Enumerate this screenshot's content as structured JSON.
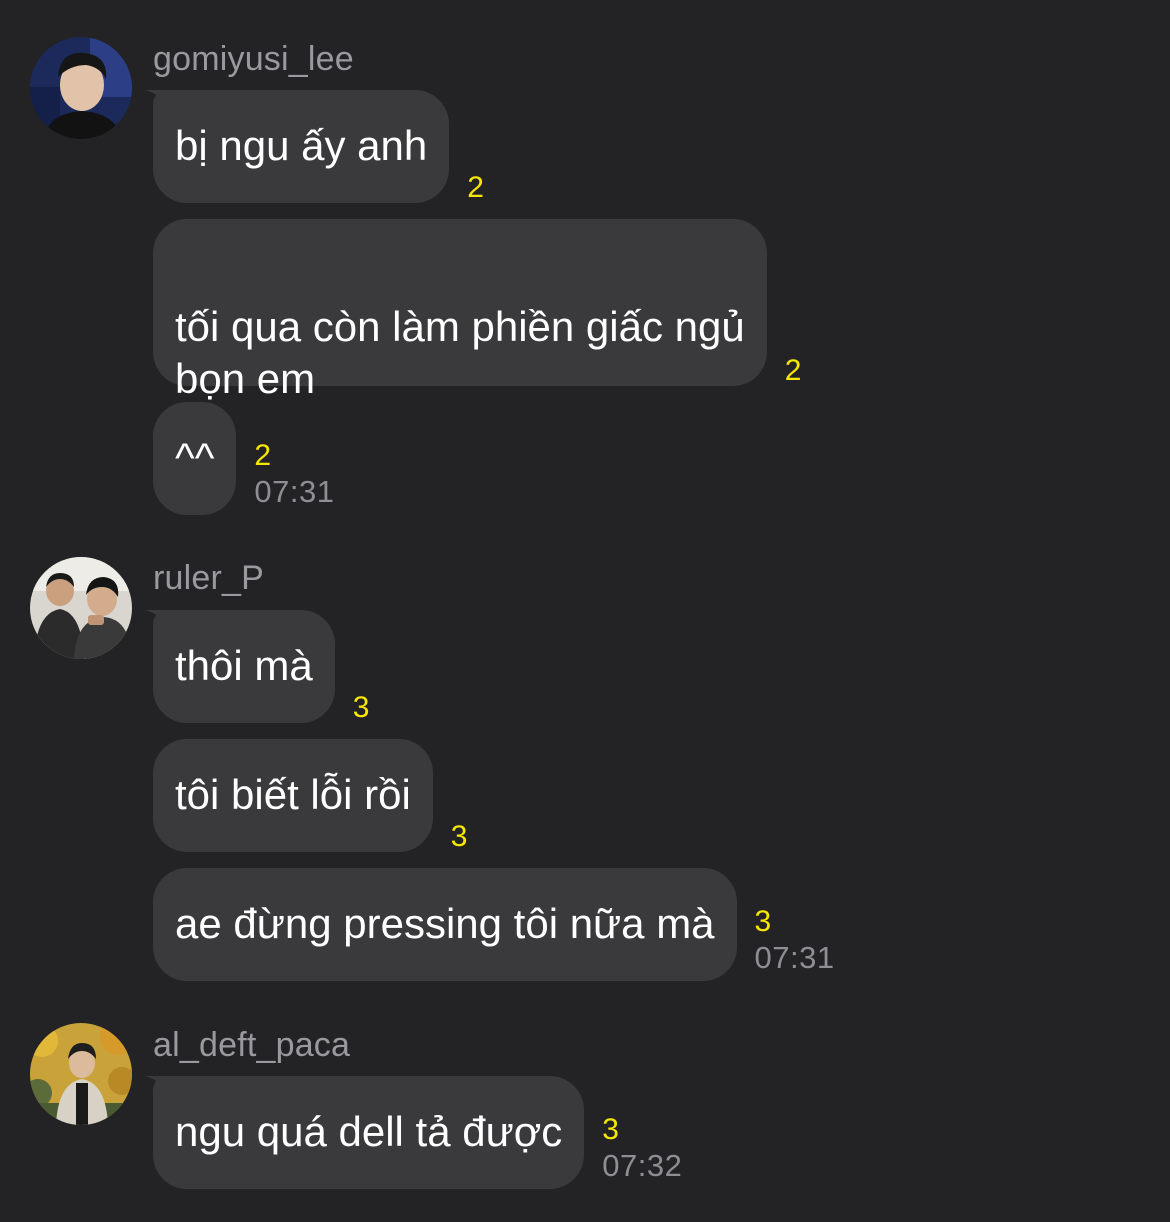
{
  "groups": [
    {
      "username": "gomiyusi_lee",
      "messages": [
        {
          "text": "bị ngu ấy anh",
          "unread": "2",
          "time": ""
        },
        {
          "text": "tối qua còn làm phiền giấc ngủ\nbọn em",
          "unread": "2",
          "time": ""
        },
        {
          "text": "^^",
          "unread": "2",
          "time": "07:31"
        }
      ]
    },
    {
      "username": "ruler_P",
      "messages": [
        {
          "text": "thôi mà",
          "unread": "3",
          "time": ""
        },
        {
          "text": "tôi biết lỗi rồi",
          "unread": "3",
          "time": ""
        },
        {
          "text": "ae đừng pressing tôi nữa mà",
          "unread": "3",
          "time": "07:31"
        }
      ]
    },
    {
      "username": "al_deft_paca",
      "messages": [
        {
          "text": "ngu quá dell tả được",
          "unread": "3",
          "time": "07:32"
        }
      ]
    }
  ],
  "colors": {
    "background": "#232325",
    "bubble": "#3a3a3c",
    "unread": "#f7e600",
    "time": "#8e8e93",
    "username": "#9a9a9e"
  }
}
